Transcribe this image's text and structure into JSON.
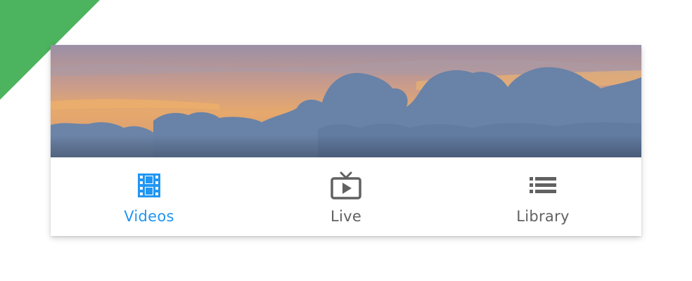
{
  "colors": {
    "corner": "#4cb45e",
    "active": "#2196f3",
    "inactive": "#616161"
  },
  "banner": {
    "description_icon": "sunset-clouds-image"
  },
  "bottom_nav": {
    "items": [
      {
        "label": "Videos",
        "icon": "film-strip-icon",
        "active": true
      },
      {
        "label": "Live",
        "icon": "live-tv-icon",
        "active": false
      },
      {
        "label": "Library",
        "icon": "list-icon",
        "active": false
      }
    ]
  }
}
